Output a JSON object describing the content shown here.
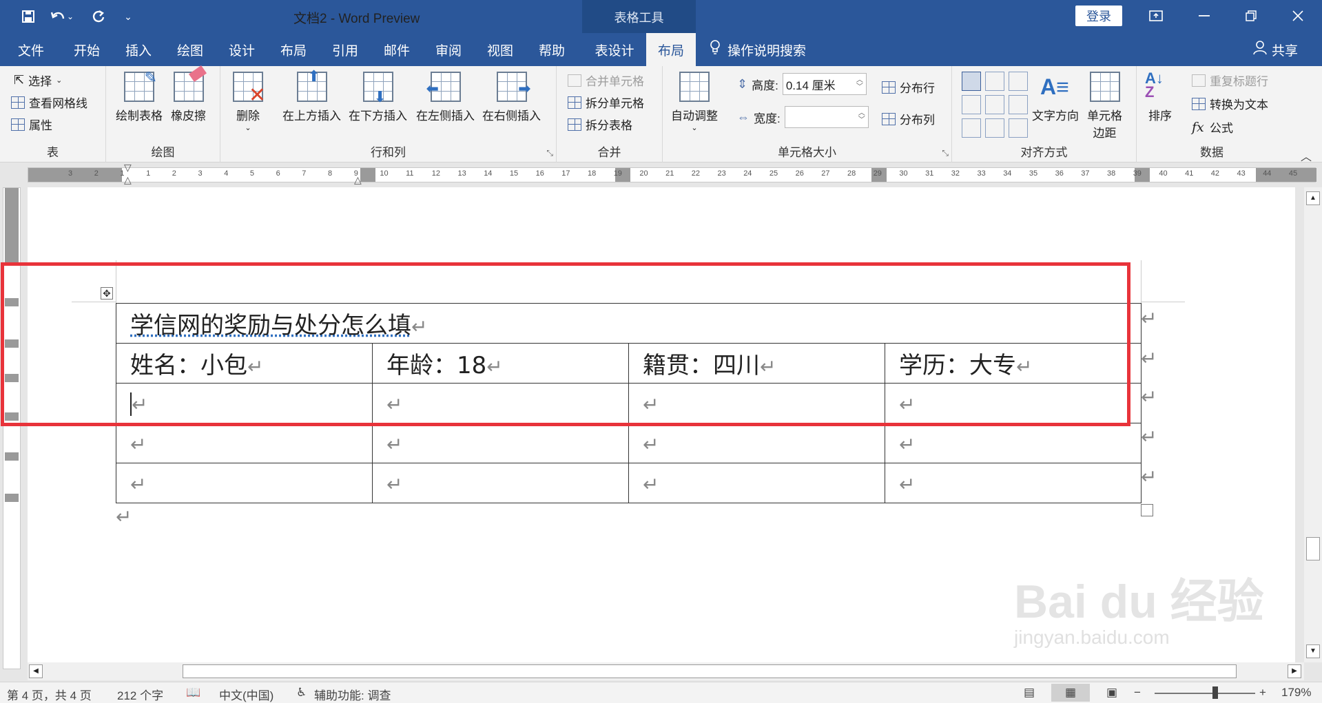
{
  "app": {
    "title": "文档2  -  Word Preview",
    "context_label": "表格工具",
    "login_label": "登录",
    "share_label": "共享",
    "search_label": "操作说明搜索"
  },
  "tabs": [
    "文件",
    "开始",
    "插入",
    "绘图",
    "设计",
    "布局",
    "引用",
    "邮件",
    "审阅",
    "视图",
    "帮助",
    "表设计",
    "布局"
  ],
  "ribbon": {
    "table_group": {
      "label": "表",
      "select": "选择",
      "gridlines": "查看网格线",
      "properties": "属性"
    },
    "draw_group": {
      "label": "绘图",
      "draw_table": "绘制表格",
      "eraser": "橡皮擦"
    },
    "rows_cols_group": {
      "label": "行和列",
      "delete": "删除",
      "insert_above": "在上方插入",
      "insert_below": "在下方插入",
      "insert_left": "在左侧插入",
      "insert_right": "在右侧插入"
    },
    "merge_group": {
      "label": "合并",
      "merge_cells": "合并单元格",
      "split_cells": "拆分单元格",
      "split_table": "拆分表格"
    },
    "cell_size_group": {
      "label": "单元格大小",
      "autofit": "自动调整",
      "height_label": "高度:",
      "height_value": "0.14 厘米",
      "width_label": "宽度:",
      "width_value": "",
      "distribute_rows": "分布行",
      "distribute_cols": "分布列"
    },
    "align_group": {
      "label": "对齐方式",
      "text_direction": "文字方向",
      "cell_margins_1": "单元格",
      "cell_margins_2": "边距"
    },
    "data_group": {
      "label": "数据",
      "sort": "排序",
      "repeat_header": "重复标题行",
      "convert_text": "转换为文本",
      "formula": "公式"
    }
  },
  "ruler_ticks": [
    "3",
    "2",
    "1",
    "1",
    "2",
    "3",
    "4",
    "5",
    "6",
    "7",
    "8",
    "9",
    "10",
    "11",
    "12",
    "13",
    "14",
    "15",
    "16",
    "17",
    "18",
    "19",
    "20",
    "21",
    "22",
    "23",
    "24",
    "25",
    "26",
    "27",
    "28",
    "29",
    "30",
    "31",
    "32",
    "33",
    "34",
    "35",
    "36",
    "37",
    "38",
    "39",
    "40",
    "41",
    "42",
    "43",
    "44",
    "45"
  ],
  "document": {
    "table_title": "学信网的奖励与处分怎么填",
    "row2": [
      "姓名：小包",
      "年龄：18",
      "籍贯：四川",
      "学历：大专"
    ],
    "para_mark": "↵"
  },
  "statusbar": {
    "page": "第 4 页，共 4 页",
    "words": "212 个字",
    "lang": "中文(中国)",
    "accessibility": "辅助功能: 调查",
    "zoom": "179%"
  },
  "watermark": {
    "brand": "Bai du 经验",
    "url": "jingyan.baidu.com"
  }
}
